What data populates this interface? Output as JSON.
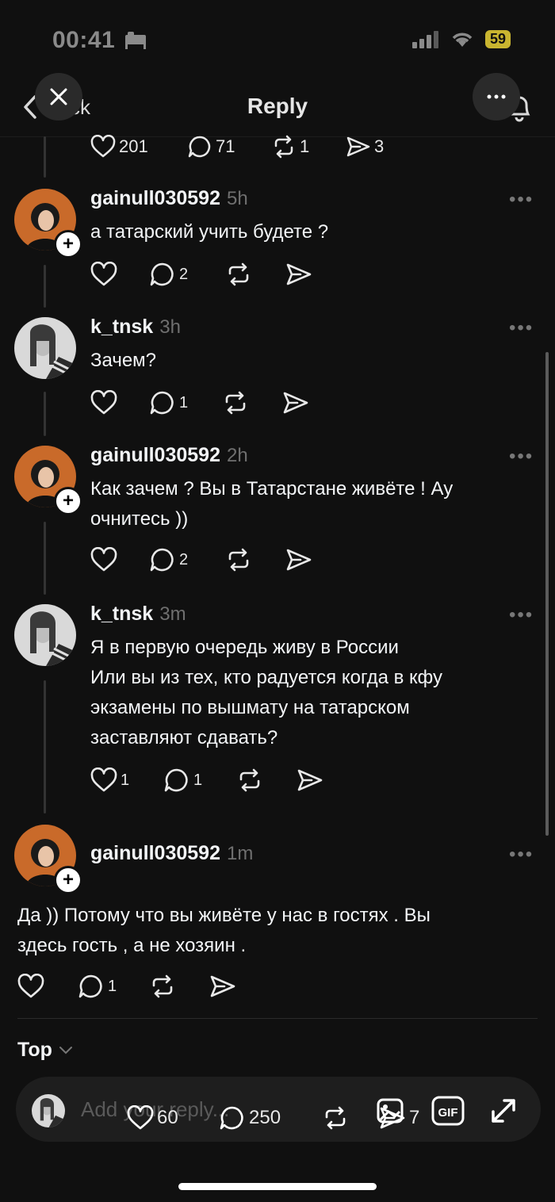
{
  "status": {
    "time": "00:41",
    "battery": "59"
  },
  "nav": {
    "title": "Reply",
    "back_label": "ck"
  },
  "top_stats": {
    "likes": "201",
    "replies": "71",
    "reposts": "1",
    "shares": "3"
  },
  "replies": [
    {
      "username": "gainull030592",
      "time": "5h",
      "text": [
        "а татарский учить будете ?"
      ],
      "likes": "",
      "replies": "2"
    },
    {
      "username": "k_tnsk",
      "time": "3h",
      "text": [
        "Зачем?"
      ],
      "likes": "",
      "replies": "1"
    },
    {
      "username": "gainull030592",
      "time": "2h",
      "text": [
        "Как зачем ? Вы в Татарстане живёте ! Ау",
        "очнитесь ))"
      ],
      "likes": "",
      "replies": "2"
    },
    {
      "username": "k_tnsk",
      "time": "3m",
      "text": [
        "Я в первую очередь живу в России",
        "Или вы из тех, кто радуется когда в кфу",
        "экзамены по вышмату на татарском",
        "заставляют сдавать?"
      ],
      "likes": "1",
      "replies": "1"
    },
    {
      "username": "gainull030592",
      "time": "1m",
      "text": [
        "Да )) Потому что вы живёте у нас в гостях . Вы",
        "здесь гость , а не хозяин ."
      ],
      "likes": "",
      "replies": "1"
    }
  ],
  "sort": {
    "label": "Top"
  },
  "composer": {
    "placeholder": "Add your reply..."
  },
  "overlay_stats": {
    "likes": "60",
    "replies": "250",
    "shares": "7"
  },
  "colors": {
    "background": "#101010",
    "text": "#f3f5f7",
    "muted": "#777777",
    "battery": "#c9b530"
  }
}
